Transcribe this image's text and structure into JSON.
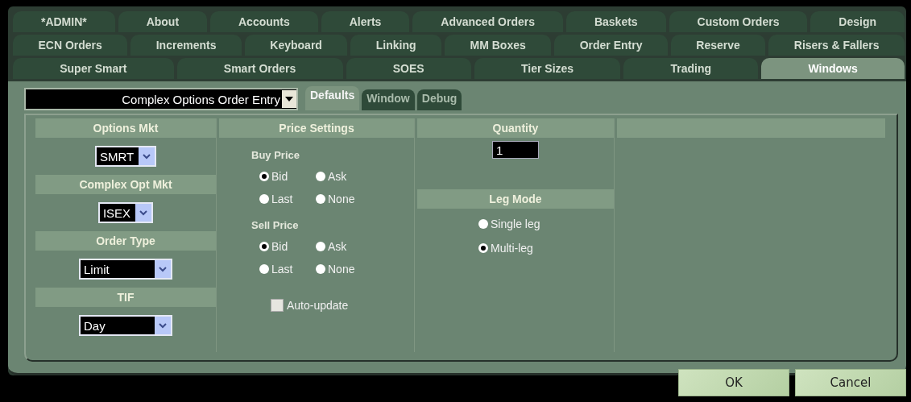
{
  "tab_rows": [
    {
      "tabs": [
        {
          "label": "*ADMIN*",
          "selected": false
        },
        {
          "label": "About",
          "selected": false
        },
        {
          "label": "Accounts",
          "selected": false
        },
        {
          "label": "Alerts",
          "selected": false
        },
        {
          "label": "Advanced Orders",
          "selected": false
        },
        {
          "label": "Baskets",
          "selected": false
        },
        {
          "label": "Custom Orders",
          "selected": false
        },
        {
          "label": "Design",
          "selected": false
        }
      ]
    },
    {
      "tabs": [
        {
          "label": "ECN Orders",
          "selected": false
        },
        {
          "label": "Increments",
          "selected": false
        },
        {
          "label": "Keyboard",
          "selected": false
        },
        {
          "label": "Linking",
          "selected": false
        },
        {
          "label": "MM Boxes",
          "selected": false
        },
        {
          "label": "Order Entry",
          "selected": false
        },
        {
          "label": "Reserve",
          "selected": false
        },
        {
          "label": "Risers & Fallers",
          "selected": false
        }
      ]
    },
    {
      "tabs": [
        {
          "label": "Super Smart",
          "selected": false
        },
        {
          "label": "Smart Orders",
          "selected": false
        },
        {
          "label": "SOES",
          "selected": false
        },
        {
          "label": "Tier Sizes",
          "selected": false
        },
        {
          "label": "Trading",
          "selected": false
        },
        {
          "label": "Windows",
          "selected": true
        }
      ]
    }
  ],
  "window_selector": {
    "value": "Complex Options Order Entry"
  },
  "subtabs": [
    {
      "label": "Defaults",
      "selected": true
    },
    {
      "label": "Window",
      "selected": false
    },
    {
      "label": "Debug",
      "selected": false
    }
  ],
  "columns": [
    {
      "items": [
        {
          "kind": "header",
          "text": "Options Mkt"
        },
        {
          "kind": "dropdown",
          "value": "SMRT"
        },
        {
          "kind": "header",
          "text": "Complex Opt Mkt"
        },
        {
          "kind": "dropdown",
          "value": "ISEX"
        },
        {
          "kind": "header",
          "text": "Order Type"
        },
        {
          "kind": "dropdown",
          "value": "Limit",
          "wide": true
        },
        {
          "kind": "header",
          "text": "TIF"
        },
        {
          "kind": "dropdown",
          "value": "Day",
          "wide": true
        }
      ]
    },
    {
      "items": [
        {
          "kind": "header",
          "text": "Price Settings"
        },
        {
          "kind": "label",
          "text": "Buy Price"
        },
        {
          "kind": "radio_grid",
          "options": [
            {
              "label": "Bid",
              "selected": true
            },
            {
              "label": "Ask",
              "selected": false
            },
            {
              "label": "Last",
              "selected": false
            },
            {
              "label": "None",
              "selected": false
            }
          ]
        },
        {
          "kind": "label",
          "text": "Sell Price"
        },
        {
          "kind": "radio_grid",
          "options": [
            {
              "label": "Bid",
              "selected": true
            },
            {
              "label": "Ask",
              "selected": false
            },
            {
              "label": "Last",
              "selected": false
            },
            {
              "label": "None",
              "selected": false
            }
          ]
        },
        {
          "kind": "checkbox",
          "label": "Auto-update",
          "checked": false
        }
      ]
    },
    {
      "items": [
        {
          "kind": "header",
          "text": "Quantity"
        },
        {
          "kind": "field",
          "value": "1"
        },
        {
          "kind": "header",
          "text": "Leg Mode"
        },
        {
          "kind": "radio_list",
          "options": [
            {
              "label": "Single leg",
              "selected": false
            },
            {
              "label": "Multi-leg",
              "selected": true
            }
          ]
        }
      ]
    },
    {
      "items": [
        {
          "kind": "header"
        }
      ]
    }
  ],
  "buttons": [
    {
      "label": "OK"
    },
    {
      "label": "Cancel"
    }
  ]
}
